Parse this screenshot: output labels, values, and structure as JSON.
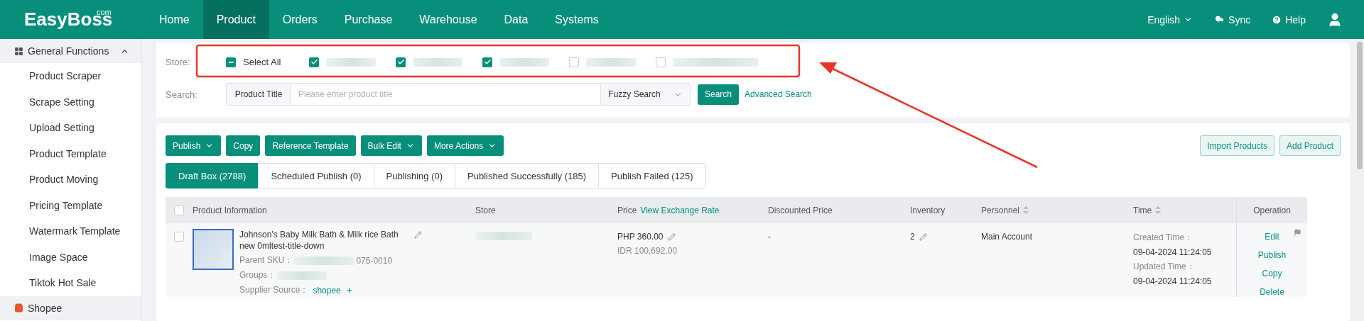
{
  "brand": {
    "name": "EasyBoss",
    "suffix": "com"
  },
  "nav": [
    {
      "label": "Home",
      "selected": false
    },
    {
      "label": "Product",
      "selected": true
    },
    {
      "label": "Orders",
      "selected": false
    },
    {
      "label": "Purchase",
      "selected": false
    },
    {
      "label": "Warehouse",
      "selected": false
    },
    {
      "label": "Data",
      "selected": false
    },
    {
      "label": "Systems",
      "selected": false
    }
  ],
  "header_actions": {
    "language": "English",
    "sync": "Sync",
    "help": "Help"
  },
  "sidebar": {
    "group": {
      "label": "General Functions",
      "expanded": true
    },
    "items": [
      "Product Scraper",
      "Scrape Setting",
      "Upload Setting",
      "Product Template",
      "Product Moving",
      "Pricing Template",
      "Watermark Template",
      "Image Space",
      "Tiktok Hot Sale"
    ],
    "next_group": "Shopee"
  },
  "store": {
    "label": "Store:",
    "select_all": {
      "label": "Select All",
      "indeterminate": true
    },
    "stores": [
      {
        "checked": true
      },
      {
        "checked": true
      },
      {
        "checked": true
      },
      {
        "checked": false
      },
      {
        "checked": false
      }
    ]
  },
  "search": {
    "label": "Search:",
    "field_type": "Product Title",
    "placeholder": "Please enter product title",
    "mode": "Fuzzy Search",
    "button": "Search",
    "advanced": "Advanced Search"
  },
  "toolbar": [
    {
      "label": "Publish",
      "dropdown": true
    },
    {
      "label": "Copy",
      "dropdown": false
    },
    {
      "label": "Reference Template",
      "dropdown": false
    },
    {
      "label": "Bulk Edit",
      "dropdown": true
    },
    {
      "label": "More Actions",
      "dropdown": true
    }
  ],
  "right_buttons": [
    "Import Products",
    "Add Product"
  ],
  "tabs": [
    {
      "label": "Draft Box (2788)",
      "selected": true
    },
    {
      "label": "Scheduled Publish (0)",
      "selected": false
    },
    {
      "label": "Publishing (0)",
      "selected": false
    },
    {
      "label": "Published Successfully (185)",
      "selected": false
    },
    {
      "label": "Publish Failed (125)",
      "selected": false
    }
  ],
  "table": {
    "all_selected": false,
    "columns": [
      {
        "label": "Product Information",
        "sortable": false
      },
      {
        "label": "Store",
        "sortable": false
      },
      {
        "label": "Price",
        "sortable": false,
        "link": "View Exchange Rate"
      },
      {
        "label": "Discounted Price",
        "sortable": false
      },
      {
        "label": "Inventory",
        "sortable": false
      },
      {
        "label": "Personnel",
        "sortable": true
      },
      {
        "label": "Time",
        "sortable": true
      },
      {
        "label": "Operation",
        "sortable": false
      }
    ],
    "rows": [
      {
        "selected": false,
        "title": "Johnson's Baby Milk Bath & Milk rice Bath new 0mltest-title-down",
        "parent_sku_label": "Parent SKU：",
        "parent_sku_tail": "075-0010",
        "groups_label": "Groups：",
        "supplier_label": "Supplier Source：",
        "supplier": "shopee",
        "price": "PHP 360.00",
        "price_converted": "IDR 100,692.00",
        "discounted": "-",
        "inventory": "2",
        "personnel": "Main Account",
        "created_label": "Created Time：",
        "created": "09-04-2024 11:24:05",
        "updated_label": "Updated Time：",
        "updated": "09-04-2024 11:24:05",
        "operations": [
          "Edit",
          "Publish",
          "Copy",
          "Delete"
        ]
      }
    ]
  }
}
